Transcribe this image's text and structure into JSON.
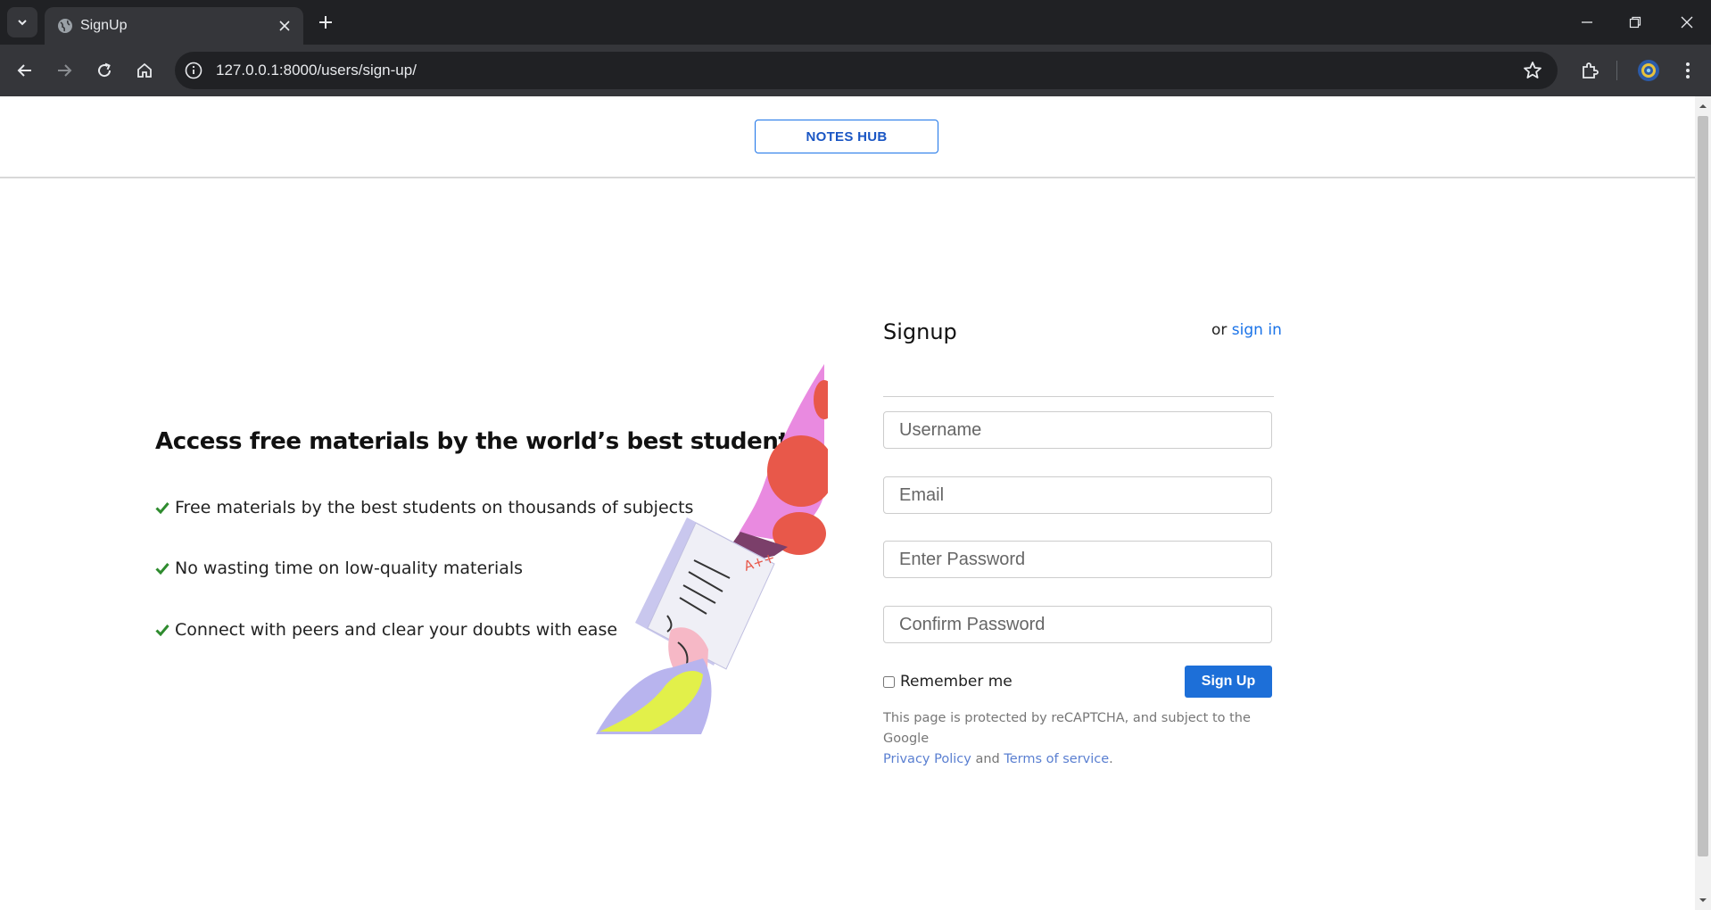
{
  "browser": {
    "tab_title": "SignUp",
    "url": "127.0.0.1:8000/users/sign-up/"
  },
  "header": {
    "brand": "NOTES HUB"
  },
  "promo": {
    "heading": "Access free materials by the world’s best students",
    "features": [
      "Free materials by the best students on thousands of subjects",
      "No wasting time on low-quality materials",
      "Connect with peers and clear your doubts with ease"
    ],
    "illustration_grade": "A++"
  },
  "form": {
    "title": "Signup",
    "or_text": "or",
    "signin_link": "sign in",
    "username_placeholder": "Username",
    "email_placeholder": "Email",
    "password_placeholder": "Enter Password",
    "confirm_placeholder": "Confirm Password",
    "remember_label": "Remember me",
    "submit_label": "Sign Up",
    "recaptcha_text": "This page is protected by reCAPTCHA, and subject to the Google",
    "privacy_link": "Privacy Policy",
    "and_text": "and",
    "terms_link": "Terms of service",
    "period": "."
  },
  "colors": {
    "accent": "#1a73e8",
    "check": "#2e8b2e"
  },
  "icons": [
    "tab-list-icon",
    "globe-icon",
    "close-icon",
    "plus-icon",
    "minimize-icon",
    "restore-icon",
    "window-close-icon",
    "back-icon",
    "forward-icon",
    "reload-icon",
    "home-icon",
    "site-info-icon",
    "star-icon",
    "extensions-icon",
    "profile-avatar-icon",
    "kebab-menu-icon",
    "check-icon"
  ]
}
